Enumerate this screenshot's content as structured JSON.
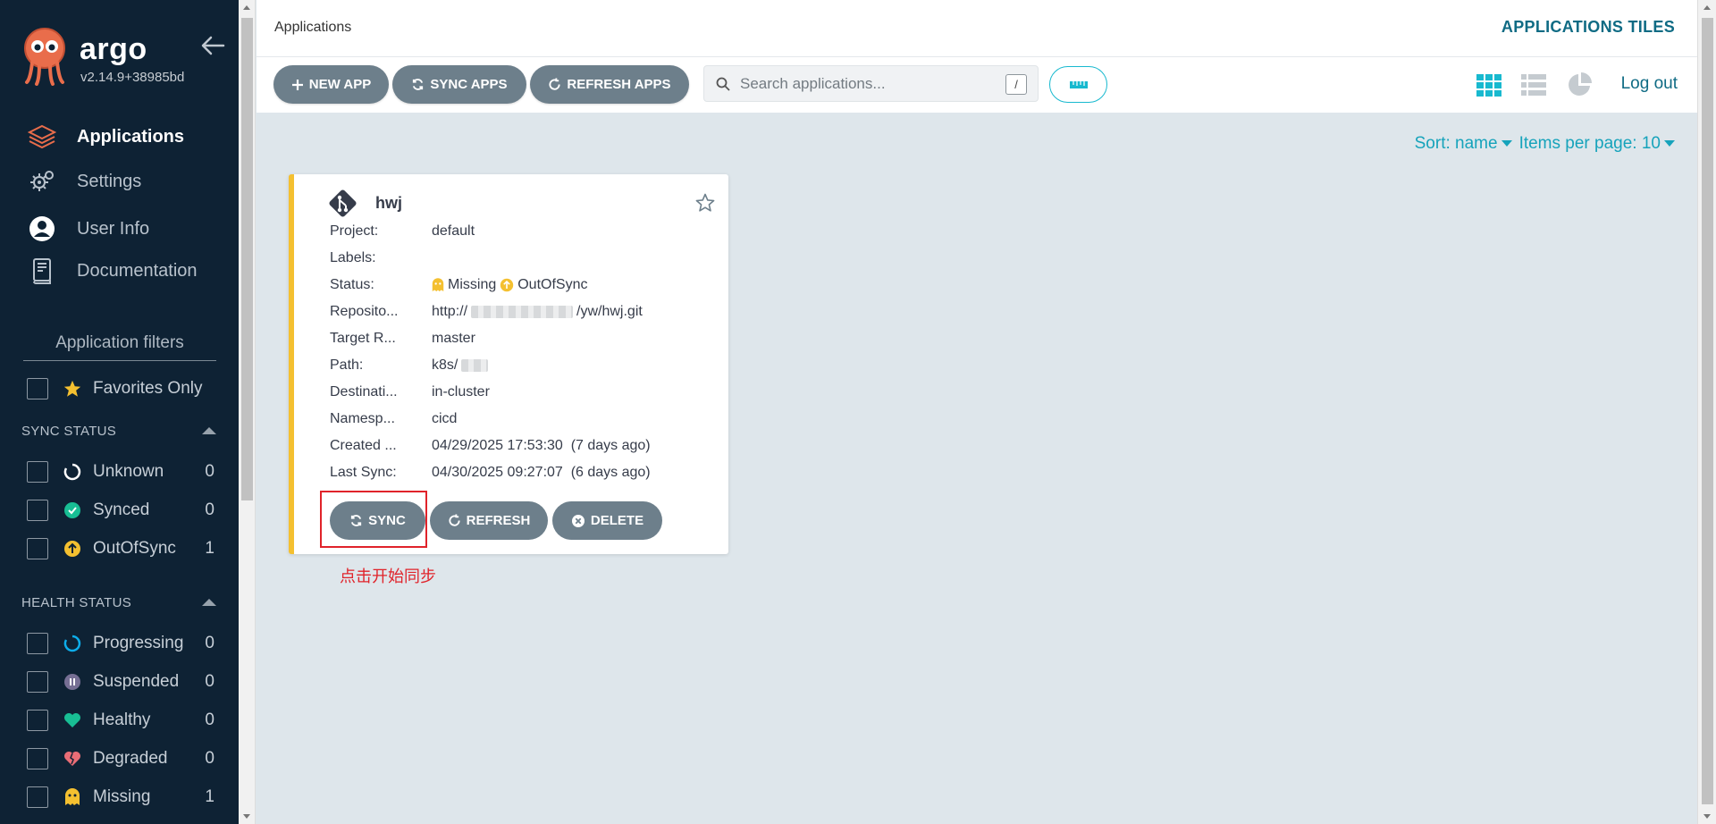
{
  "sidebar": {
    "brand": "argo",
    "version": "v2.14.9+38985bd",
    "nav": [
      {
        "label": "Applications",
        "icon": "layers-icon",
        "active": true
      },
      {
        "label": "Settings",
        "icon": "gear-icon"
      },
      {
        "label": "User Info",
        "icon": "user-circle-icon"
      },
      {
        "label": "Documentation",
        "icon": "book-icon"
      }
    ],
    "filters_title": "Application filters",
    "favorites_label": "Favorites Only",
    "sync_status": {
      "title": "SYNC STATUS",
      "items": [
        {
          "label": "Unknown",
          "count": "0",
          "color": "#ffffff"
        },
        {
          "label": "Synced",
          "count": "0",
          "color": "#18be94"
        },
        {
          "label": "OutOfSync",
          "count": "1",
          "color": "#f4c030"
        }
      ]
    },
    "health_status": {
      "title": "HEALTH STATUS",
      "items": [
        {
          "label": "Progressing",
          "count": "0",
          "color": "#0dadea"
        },
        {
          "label": "Suspended",
          "count": "0",
          "color": "#766f94"
        },
        {
          "label": "Healthy",
          "count": "0",
          "color": "#18be94"
        },
        {
          "label": "Degraded",
          "count": "0",
          "color": "#e96d76"
        },
        {
          "label": "Missing",
          "count": "1",
          "color": "#f4c030"
        }
      ]
    }
  },
  "header": {
    "breadcrumb": "Applications",
    "view_title": "APPLICATIONS TILES",
    "logout": "Log out"
  },
  "toolbar": {
    "new_app": "NEW APP",
    "sync_apps": "SYNC APPS",
    "refresh_apps": "REFRESH APPS",
    "search_placeholder": "Search applications...",
    "search_shortcut": "/"
  },
  "sort": {
    "sort_label": "Sort: name",
    "per_page_label": "Items per page: 10"
  },
  "app": {
    "name": "hwj",
    "fields": [
      {
        "key": "Project:",
        "value": "default"
      },
      {
        "key": "Labels:",
        "value": ""
      },
      {
        "key": "Status:",
        "health": "Missing",
        "sync": "OutOfSync"
      },
      {
        "key": "Reposito...",
        "value_prefix": "http://",
        "value_suffix": "/yw/hwj.git"
      },
      {
        "key": "Target R...",
        "value": "master"
      },
      {
        "key": "Path:",
        "value_prefix": "k8s/"
      },
      {
        "key": "Destinati...",
        "value": "in-cluster"
      },
      {
        "key": "Namesp...",
        "value": "cicd"
      },
      {
        "key": "Created ...",
        "value": "04/29/2025 17:53:30  (7 days ago)"
      },
      {
        "key": "Last Sync:",
        "value": "04/30/2025 09:27:07  (6 days ago)"
      }
    ],
    "actions": {
      "sync": "SYNC",
      "refresh": "REFRESH",
      "delete": "DELETE"
    }
  },
  "annotation": "点击开始同步",
  "colors": {
    "sidebar_bg": "#0e2234",
    "accent": "#16a3bb",
    "button_bg": "#6d7f8b",
    "card_border": "#f4c030",
    "annotation": "#e0232a"
  }
}
